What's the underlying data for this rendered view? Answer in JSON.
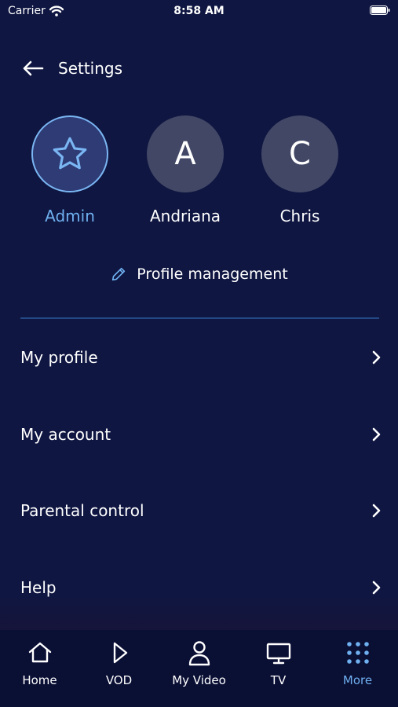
{
  "status_bar": {
    "carrier": "Carrier",
    "time": "8:58 AM"
  },
  "header": {
    "title": "Settings"
  },
  "profiles": [
    {
      "name": "Admin",
      "initial": "",
      "icon": "star-icon",
      "active": true
    },
    {
      "name": "Andriana",
      "initial": "A",
      "active": false
    },
    {
      "name": "Chris",
      "initial": "C",
      "active": false
    }
  ],
  "profile_management": {
    "label": "Profile management",
    "icon": "pencil-icon"
  },
  "menu": [
    {
      "label": "My profile"
    },
    {
      "label": "My account"
    },
    {
      "label": "Parental control"
    },
    {
      "label": "Help"
    }
  ],
  "tabs": [
    {
      "label": "Home",
      "icon": "home-icon"
    },
    {
      "label": "VOD",
      "icon": "play-icon"
    },
    {
      "label": "My Video",
      "icon": "user-icon"
    },
    {
      "label": "TV",
      "icon": "tv-icon"
    },
    {
      "label": "More",
      "icon": "grid-icon",
      "active": true
    }
  ],
  "colors": {
    "background": "#0f1641",
    "accent": "#6fb0f0",
    "avatar_bg": "#414765",
    "tabbar_bg": "#0a0f34",
    "divider": "#234884"
  }
}
